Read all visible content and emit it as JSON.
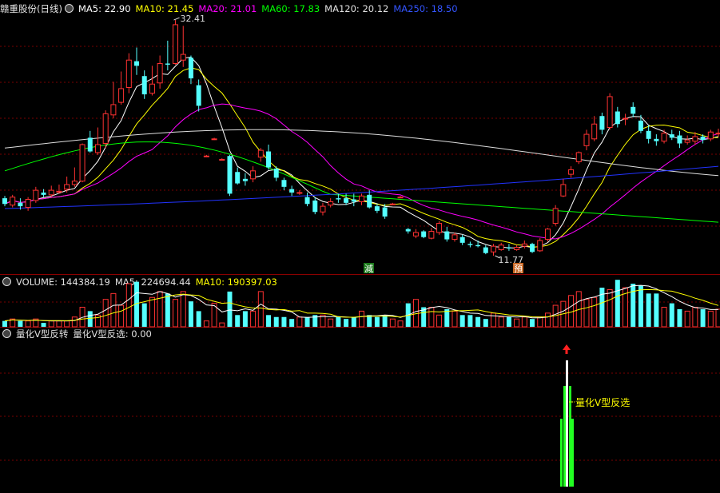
{
  "price_panel": {
    "title": "赣重股份(日线)",
    "ma": [
      {
        "label": "MA5: 22.90",
        "color": "#ffffff"
      },
      {
        "label": "MA10: 21.45",
        "color": "#ffff00"
      },
      {
        "label": "MA20: 21.01",
        "color": "#ff00ff"
      },
      {
        "label": "MA60: 17.83",
        "color": "#00ff00"
      },
      {
        "label": "MA120: 20.12",
        "color": "#e0e0e0"
      },
      {
        "label": "MA250: 18.50",
        "color": "#3355ff"
      }
    ],
    "high_label": "32.41",
    "low_label": "11.77",
    "marker_jian": "減",
    "marker_yu": "預"
  },
  "volume_panel": {
    "label": "VOLUME: 144384.19",
    "ma5": "MA5: 224694.44",
    "ma10": "MA10: 190397.03"
  },
  "indicator_panel": {
    "title": "量化V型反转",
    "value": "量化V型反选: 0.00",
    "annotation": "量化V型反选"
  },
  "colors": {
    "up": "#ff3232",
    "down": "#54ffff",
    "bg": "#000000",
    "grid": "#8b0000"
  }
}
